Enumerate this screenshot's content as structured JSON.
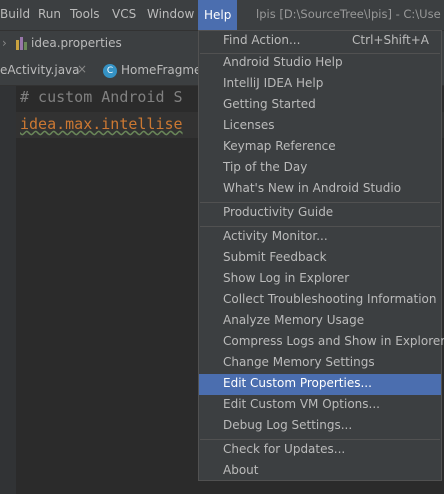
{
  "menubar": {
    "items": [
      "Build",
      "Run",
      "Tools",
      "VCS",
      "Window",
      "Help"
    ],
    "active": "Help",
    "title_text": "lpis [D:\\SourceTree\\lpis] - C:\\Use"
  },
  "navbar": {
    "label": "idea.properties"
  },
  "tabs": [
    {
      "label": "eActivity.java",
      "close": "×"
    },
    {
      "label": "HomeFragmer",
      "icon_letter": "C"
    }
  ],
  "editor": {
    "line1": "# custom Android S",
    "line2": "idea.max.intellise"
  },
  "help_menu": {
    "items": [
      {
        "label": "Find Action...",
        "shortcut": "Ctrl+Shift+A"
      },
      {
        "label": "Android Studio Help"
      },
      {
        "label": "IntelliJ IDEA Help"
      },
      {
        "label": "Getting Started"
      },
      {
        "label": "Licenses"
      },
      {
        "label": "Keymap Reference"
      },
      {
        "label": "Tip of the Day"
      },
      {
        "label": "What's New in Android Studio"
      },
      {
        "label": "Productivity Guide"
      },
      {
        "label": "Activity Monitor..."
      },
      {
        "label": "Submit Feedback"
      },
      {
        "label": "Show Log in Explorer"
      },
      {
        "label": "Collect Troubleshooting Information"
      },
      {
        "label": "Analyze Memory Usage"
      },
      {
        "label": "Compress Logs and Show in Explorer"
      },
      {
        "label": "Change Memory Settings"
      },
      {
        "label": "Edit Custom Properties..."
      },
      {
        "label": "Edit Custom VM Options..."
      },
      {
        "label": "Debug Log Settings..."
      },
      {
        "label": "Check for Updates..."
      },
      {
        "label": "About"
      }
    ],
    "selected": "Edit Custom Properties..."
  },
  "colors": {
    "accent": "#4b6eaf",
    "menu_bg": "#3c3f41",
    "editor_bg": "#2b2b2b"
  }
}
